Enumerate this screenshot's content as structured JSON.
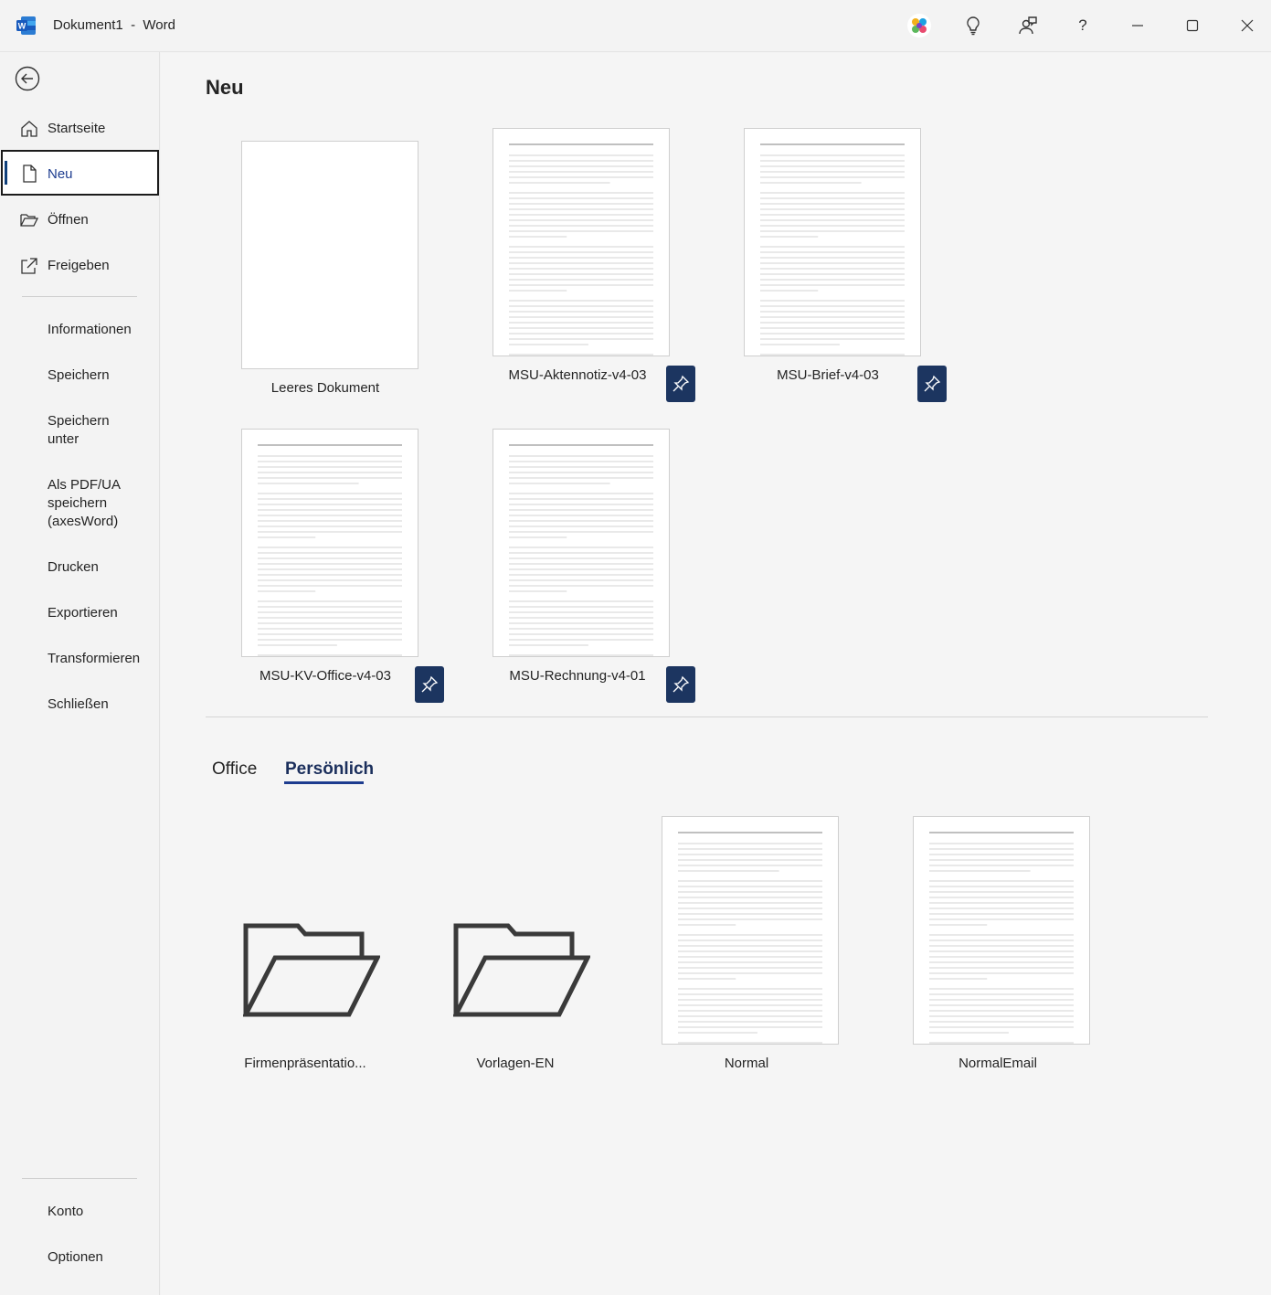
{
  "window": {
    "doc_name": "Dokument1",
    "separator": "-",
    "app_name": "Word"
  },
  "titlebar_icons": [
    "copilot-icon",
    "lightbulb-icon",
    "feedback-icon",
    "help-icon",
    "minimize-icon",
    "maximize-icon",
    "close-icon"
  ],
  "help_glyph": "?",
  "sidebar": {
    "items": [
      {
        "label": "Startseite",
        "icon": "home-icon"
      },
      {
        "label": "Neu",
        "icon": "new-document-icon"
      },
      {
        "label": "Öffnen",
        "icon": "open-folder-icon"
      },
      {
        "label": "Freigeben",
        "icon": "share-icon"
      }
    ],
    "secondary": [
      {
        "label": "Informationen"
      },
      {
        "label": "Speichern"
      },
      {
        "label_line1": "Speichern",
        "label_line2": "unter"
      },
      {
        "label_line1": "Als PDF/UA",
        "label_line2": "speichern",
        "label_line3": "(axesWord)"
      },
      {
        "label": "Drucken"
      },
      {
        "label": "Exportieren"
      },
      {
        "label": "Transformieren"
      },
      {
        "label": "Schließen"
      }
    ],
    "bottom": [
      {
        "label": "Konto"
      },
      {
        "label": "Optionen"
      }
    ]
  },
  "main": {
    "title": "Neu",
    "templates": [
      {
        "label": "Leeres Dokument",
        "blank": true
      },
      {
        "label": "MSU-Aktennotiz-v4-03",
        "pinned": true
      },
      {
        "label": "MSU-Brief-v4-03",
        "pinned": true
      },
      {
        "label": "MSU-KV-Office-v4-03",
        "pinned": true
      },
      {
        "label": "MSU-Rechnung-v4-01",
        "pinned": true
      }
    ],
    "tabs": [
      {
        "label": "Office",
        "active": false
      },
      {
        "label": "Persönlich",
        "active": true
      }
    ],
    "personal": [
      {
        "label": "Firmenpräsentatio...",
        "kind": "folder"
      },
      {
        "label": "Vorlagen-EN",
        "kind": "folder"
      },
      {
        "label": "Normal",
        "kind": "document"
      },
      {
        "label": "NormalEmail",
        "kind": "document"
      }
    ]
  },
  "colors": {
    "accent": "#1d3c8f",
    "pin_bg": "#1c3560",
    "sidebar_bg": "#f3f3f3",
    "main_bg": "#f5f5f5"
  }
}
